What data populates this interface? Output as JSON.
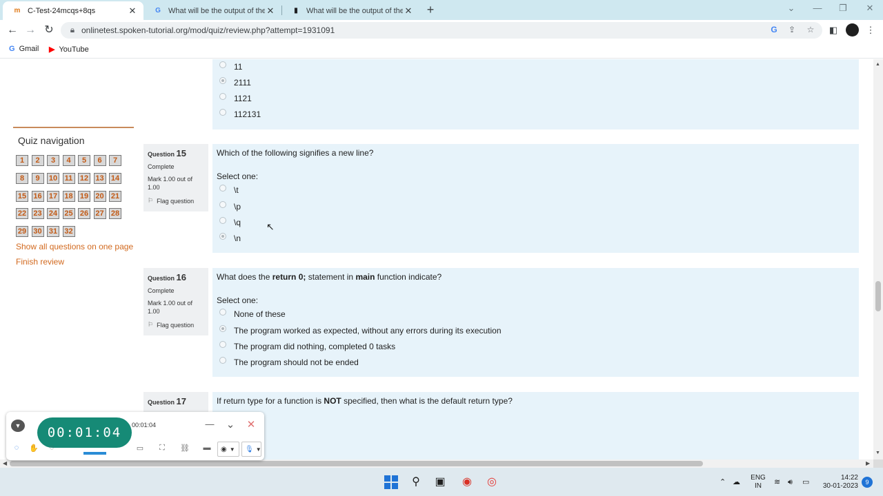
{
  "browser": {
    "tabs": [
      {
        "title": "C-Test-24mcqs+8qs",
        "favicon": "moodle-icon",
        "active": true
      },
      {
        "title": "What will be the output of the pr",
        "favicon": "google-icon",
        "active": false
      },
      {
        "title": "What will be the output of the fo",
        "favicon": "page-icon",
        "active": false
      }
    ],
    "url": "onlinetest.spoken-tutorial.org/mod/quiz/review.php?attempt=1931091",
    "bookmarks": [
      {
        "label": "Gmail",
        "icon": "google-icon"
      },
      {
        "label": "YouTube",
        "icon": "youtube-icon"
      }
    ]
  },
  "quiz_nav": {
    "title": "Quiz navigation",
    "numbers": [
      "1",
      "2",
      "3",
      "4",
      "5",
      "6",
      "7",
      "8",
      "9",
      "10",
      "11",
      "12",
      "13",
      "14",
      "15",
      "16",
      "17",
      "18",
      "19",
      "20",
      "21",
      "22",
      "23",
      "24",
      "25",
      "26",
      "27",
      "28",
      "29",
      "30",
      "31",
      "32"
    ],
    "show_all": "Show all questions on one page",
    "finish": "Finish review"
  },
  "prev_question": {
    "options": [
      "11",
      "2111",
      "1121",
      "112131"
    ],
    "selected_index": 1
  },
  "questions": [
    {
      "label": "Question",
      "number": "15",
      "status": "Complete",
      "mark": "Mark 1.00 out of 1.00",
      "flag": "Flag question",
      "text": "Which of the following signifies a new line?",
      "select_label": "Select one:",
      "options": [
        "\\t",
        "\\p",
        "\\q",
        "\\n"
      ],
      "selected_index": 3
    },
    {
      "label": "Question",
      "number": "16",
      "status": "Complete",
      "mark": "Mark 1.00 out of 1.00",
      "flag": "Flag question",
      "text_before": "What does the ",
      "text_bold1": "return 0;",
      "text_mid": " statement in ",
      "text_bold2": "main",
      "text_after": " function indicate?",
      "select_label": "Select one:",
      "options": [
        "None of these",
        "The program worked as expected, without any errors during its execution",
        "The program did nothing, completed 0 tasks",
        "The program should not be ended"
      ],
      "selected_index": 1
    },
    {
      "label": "Question",
      "number": "17",
      "text_before": "If return type for a function is ",
      "text_bold": "NOT",
      "text_after": " specified, then what is the default return type?"
    }
  ],
  "recorder": {
    "timer": "00:01:04",
    "small_timer": "00:01:04"
  },
  "taskbar": {
    "lang_top": "ENG",
    "lang_bottom": "IN",
    "time": "14:22",
    "date": "30-01-2023",
    "notifications": "9"
  }
}
